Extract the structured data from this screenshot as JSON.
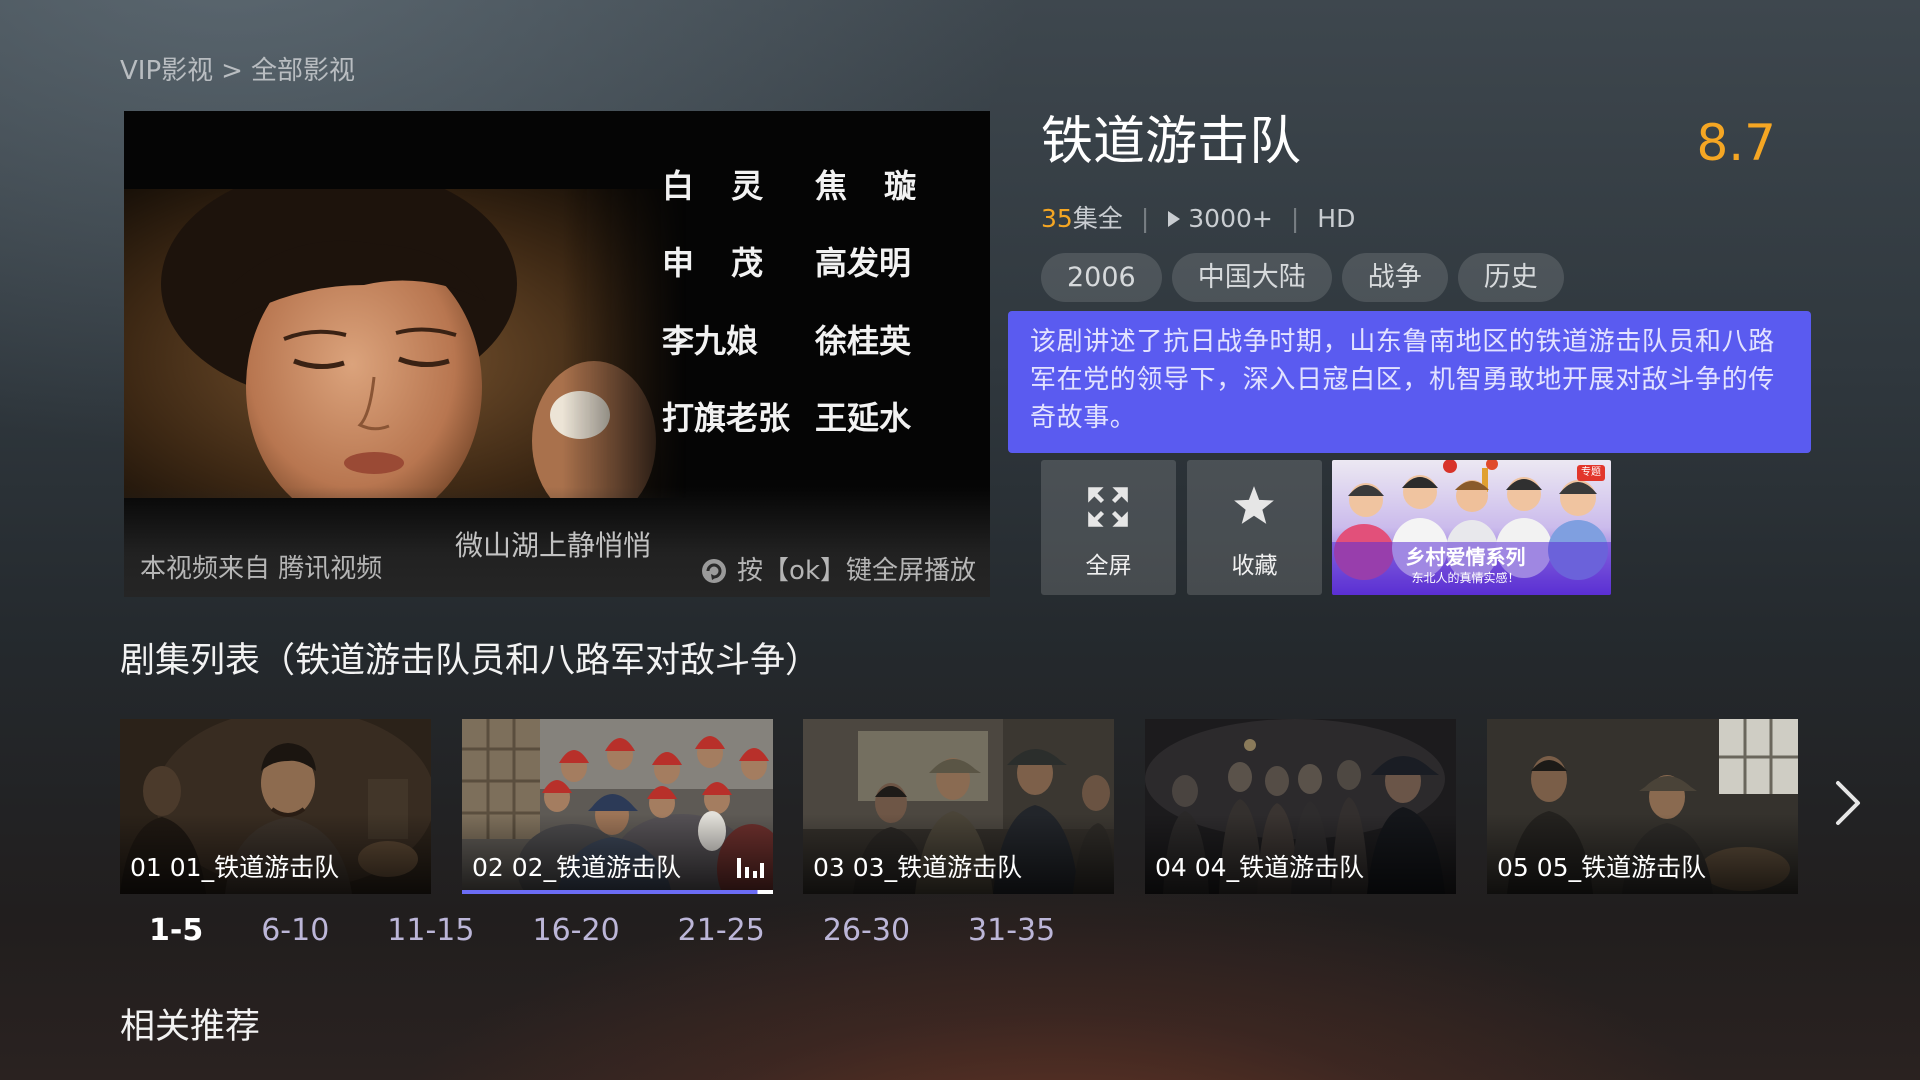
{
  "breadcrumb": {
    "items": [
      "VIP影视",
      "全部影视"
    ],
    "separator": ">"
  },
  "player": {
    "credits": [
      {
        "role": "白 灵",
        "actor": "焦 璇"
      },
      {
        "role": "申 茂",
        "actor": "高发明"
      },
      {
        "role": "李九娘",
        "actor": "徐桂英"
      },
      {
        "role": "打旗老张",
        "actor": "王延水"
      }
    ],
    "source": "本视频来自 腾讯视频",
    "caption": "微山湖上静悄悄",
    "hint": "按【ok】键全屏播放"
  },
  "detail": {
    "title": "铁道游击队",
    "rating": "8.7",
    "episode_count": "35",
    "episode_suffix": "集全",
    "separator": "|",
    "play_count": "3000+",
    "quality": "HD",
    "tags": [
      "2006",
      "中国大陆",
      "战争",
      "历史"
    ],
    "description": "该剧讲述了抗日战争时期，山东鲁南地区的铁道游击队员和八路军在党的领导下，深入日寇白区，机智勇敢地开展对敌斗争的传奇故事。"
  },
  "actions": [
    {
      "label": "全屏",
      "icon": "fullscreen-icon"
    },
    {
      "label": "收藏",
      "icon": "star-icon"
    }
  ],
  "promo": {
    "title": "乡村爱情系列",
    "subtitle": "东北人的真情实感！",
    "badge": "专题"
  },
  "episodes": {
    "title": "剧集列表（铁道游击队员和八路军对敌斗争）",
    "items": [
      {
        "label": "01 01_铁道游击队",
        "playing": false
      },
      {
        "label": "02 02_铁道游击队",
        "playing": true
      },
      {
        "label": "03 03_铁道游击队",
        "playing": false
      },
      {
        "label": "04 04_铁道游击队",
        "playing": false
      },
      {
        "label": "05 05_铁道游击队",
        "playing": false
      }
    ],
    "ranges": [
      "1-5",
      "6-10",
      "11-15",
      "16-20",
      "21-25",
      "26-30",
      "31-35"
    ],
    "active_range": "1-5"
  },
  "related": {
    "title": "相关推荐"
  },
  "icons": {
    "play_count": "play-icon",
    "hint": "ok-key-icon",
    "now_playing": "equalizer-icon",
    "next": "chevron-right-icon"
  },
  "colors": {
    "accent": "#5a5bf0",
    "rating": "#f5a623",
    "episode_count": "#f5a623",
    "range_active": "#ffffff",
    "range_inactive": "#bcb6d8",
    "focus_bar": "#6b6cf5"
  }
}
